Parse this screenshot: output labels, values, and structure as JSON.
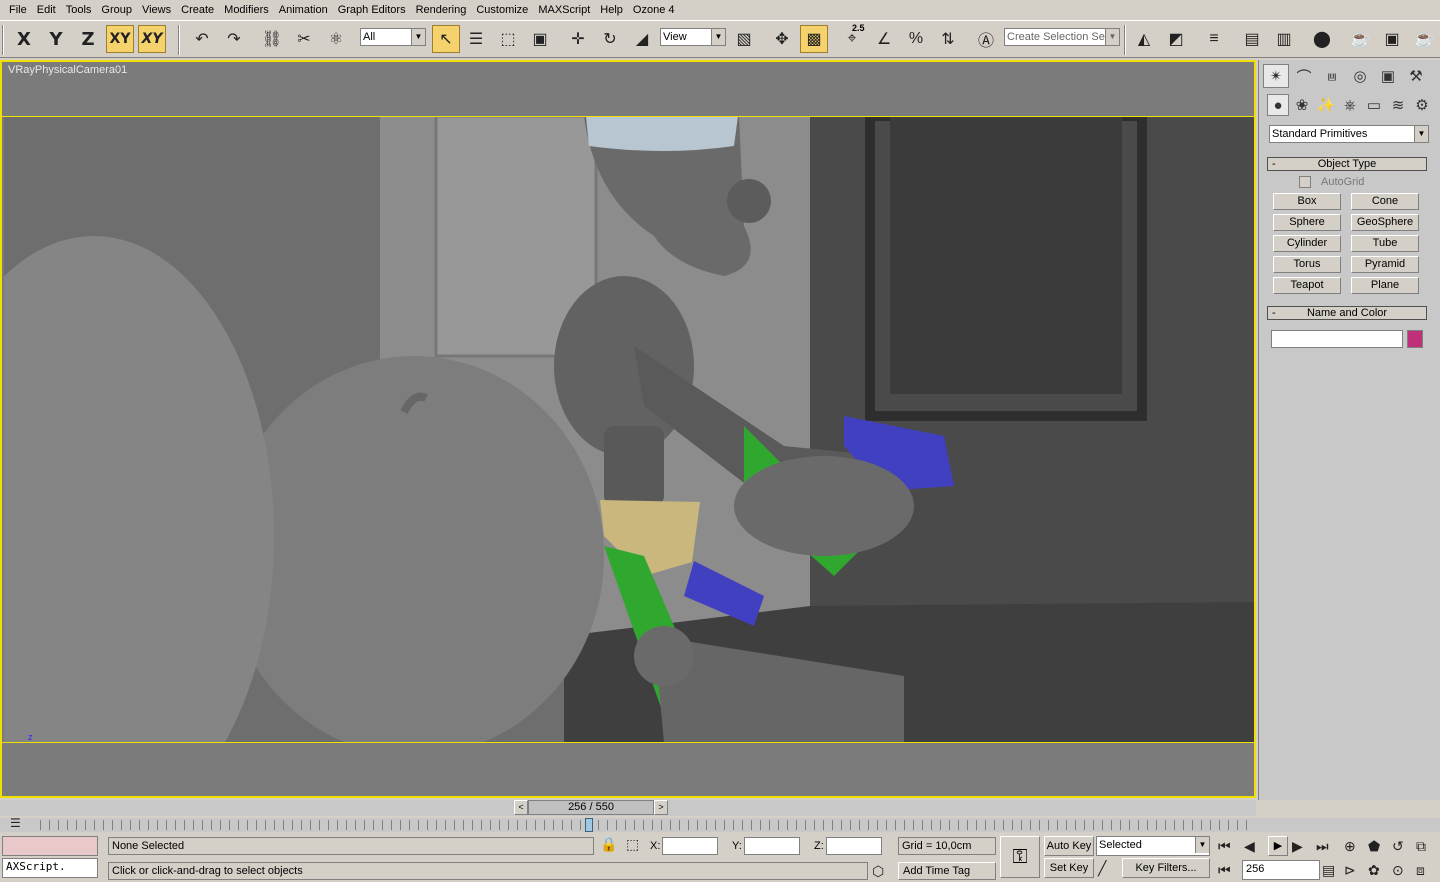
{
  "menu": [
    "File",
    "Edit",
    "Tools",
    "Group",
    "Views",
    "Create",
    "Modifiers",
    "Animation",
    "Graph Editors",
    "Rendering",
    "Customize",
    "MAXScript",
    "Help",
    "Ozone 4"
  ],
  "toolbar": {
    "axis_x": "X",
    "axis_y": "Y",
    "axis_z": "Z",
    "axis_xy": "XY",
    "axis_xy2": "XY",
    "filter_value": "All",
    "ref_coord_value": "View",
    "selection_set_placeholder": "Create Selection Set",
    "snap_angle_label": "2.5"
  },
  "viewport": {
    "label": "VRayPhysicalCamera01",
    "axis_hint": "z"
  },
  "panel": {
    "category_value": "Standard Primitives",
    "object_type_title": "Object Type",
    "autogrid_label": "AutoGrid",
    "primitives": [
      "Box",
      "Cone",
      "Sphere",
      "GeoSphere",
      "Cylinder",
      "Tube",
      "Torus",
      "Pyramid",
      "Teapot",
      "Plane"
    ],
    "name_color_title": "Name and Color",
    "name_value": "",
    "object_color": "#c0307a"
  },
  "timeline": {
    "frame_display": "256 / 550"
  },
  "status": {
    "maxscript_label": "AXScript.",
    "selection_text": "None Selected",
    "prompt_text": "Click or click-and-drag to select objects",
    "x_label": "X:",
    "y_label": "Y:",
    "z_label": "Z:",
    "x_value": "",
    "y_value": "",
    "z_value": "",
    "grid_text": "Grid = 10,0cm",
    "add_time_tag": "Add Time Tag",
    "auto_key": "Auto Key",
    "set_key": "Set Key",
    "key_mode_value": "Selected",
    "key_filters": "Key Filters...",
    "current_frame": "256"
  },
  "colors": {
    "viewport_border": "#f0e000",
    "active_button": "#f5d26b"
  }
}
